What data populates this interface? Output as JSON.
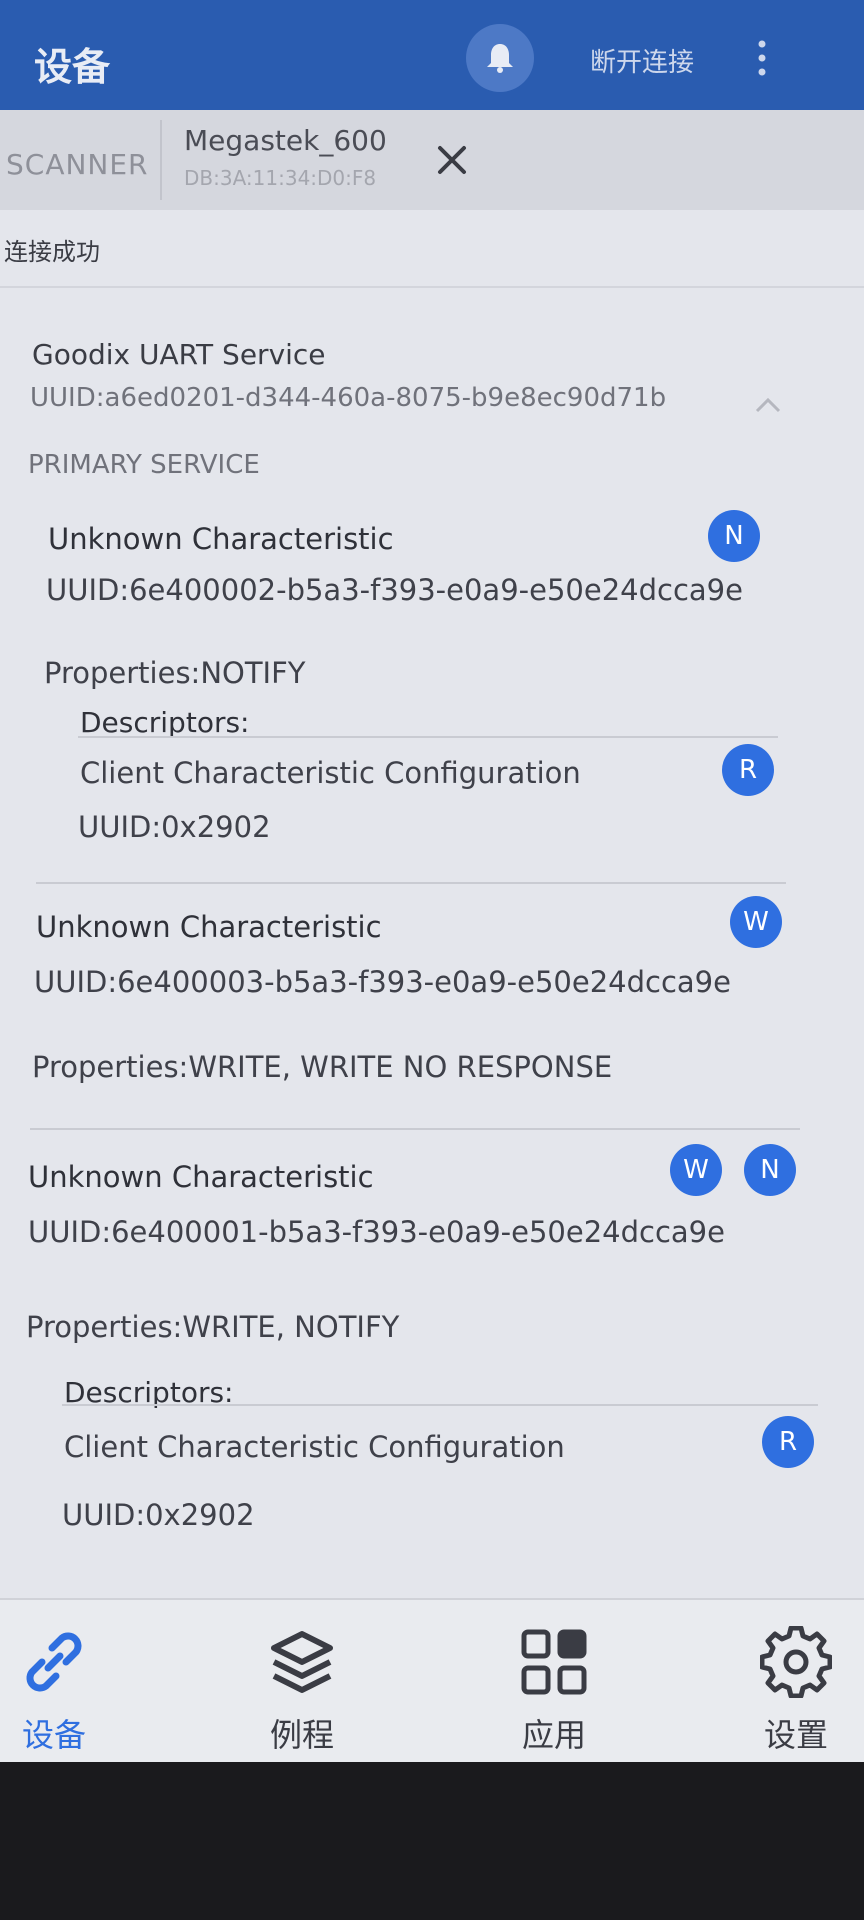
{
  "appbar": {
    "title": "设备",
    "disconnect_label": "断开连接",
    "bell_icon": "bell-icon",
    "more_icon": "more-vert-icon"
  },
  "scanner": {
    "label": "SCANNER",
    "device_name": "Megastek_600",
    "device_mac": "DB:3A:11:34:D0:F8",
    "close_icon": "close-icon"
  },
  "status": "连接成功",
  "service": {
    "name": "Goodix UART Service",
    "uuid": "UUID:a6ed0201-d344-460a-8075-b9e8ec90d71b",
    "type": "PRIMARY SERVICE",
    "collapse_icon": "chevron-up-icon"
  },
  "characteristics": [
    {
      "name": "Unknown Characteristic",
      "uuid": "UUID:6e400002-b5a3-f393-e0a9-e50e24dcca9e",
      "properties": "Properties:NOTIFY",
      "badges": [
        "N"
      ],
      "descriptors_label": "Descriptors:",
      "descriptor": {
        "name": "Client Characteristic Configuration",
        "uuid": "UUID:0x2902",
        "badge": "R"
      }
    },
    {
      "name": "Unknown Characteristic",
      "uuid": "UUID:6e400003-b5a3-f393-e0a9-e50e24dcca9e",
      "properties": "Properties:WRITE, WRITE NO RESPONSE",
      "badges": [
        "W"
      ]
    },
    {
      "name": "Unknown Characteristic",
      "uuid": "UUID:6e400001-b5a3-f393-e0a9-e50e24dcca9e",
      "properties": "Properties:WRITE, NOTIFY",
      "badges": [
        "W",
        "N"
      ],
      "descriptors_label": "Descriptors:",
      "descriptor": {
        "name": "Client Characteristic Configuration",
        "uuid": "UUID:0x2902",
        "badge": "R"
      }
    }
  ],
  "bottom_nav": [
    {
      "label": "设备",
      "icon": "link-icon",
      "active": true
    },
    {
      "label": "例程",
      "icon": "layers-icon",
      "active": false
    },
    {
      "label": "应用",
      "icon": "apps-grid-icon",
      "active": false
    },
    {
      "label": "设置",
      "icon": "gear-icon",
      "active": false
    }
  ],
  "colors": {
    "appbar": "#2a5cb0",
    "accent": "#2f6fe0",
    "background": "#e4e6ec"
  }
}
